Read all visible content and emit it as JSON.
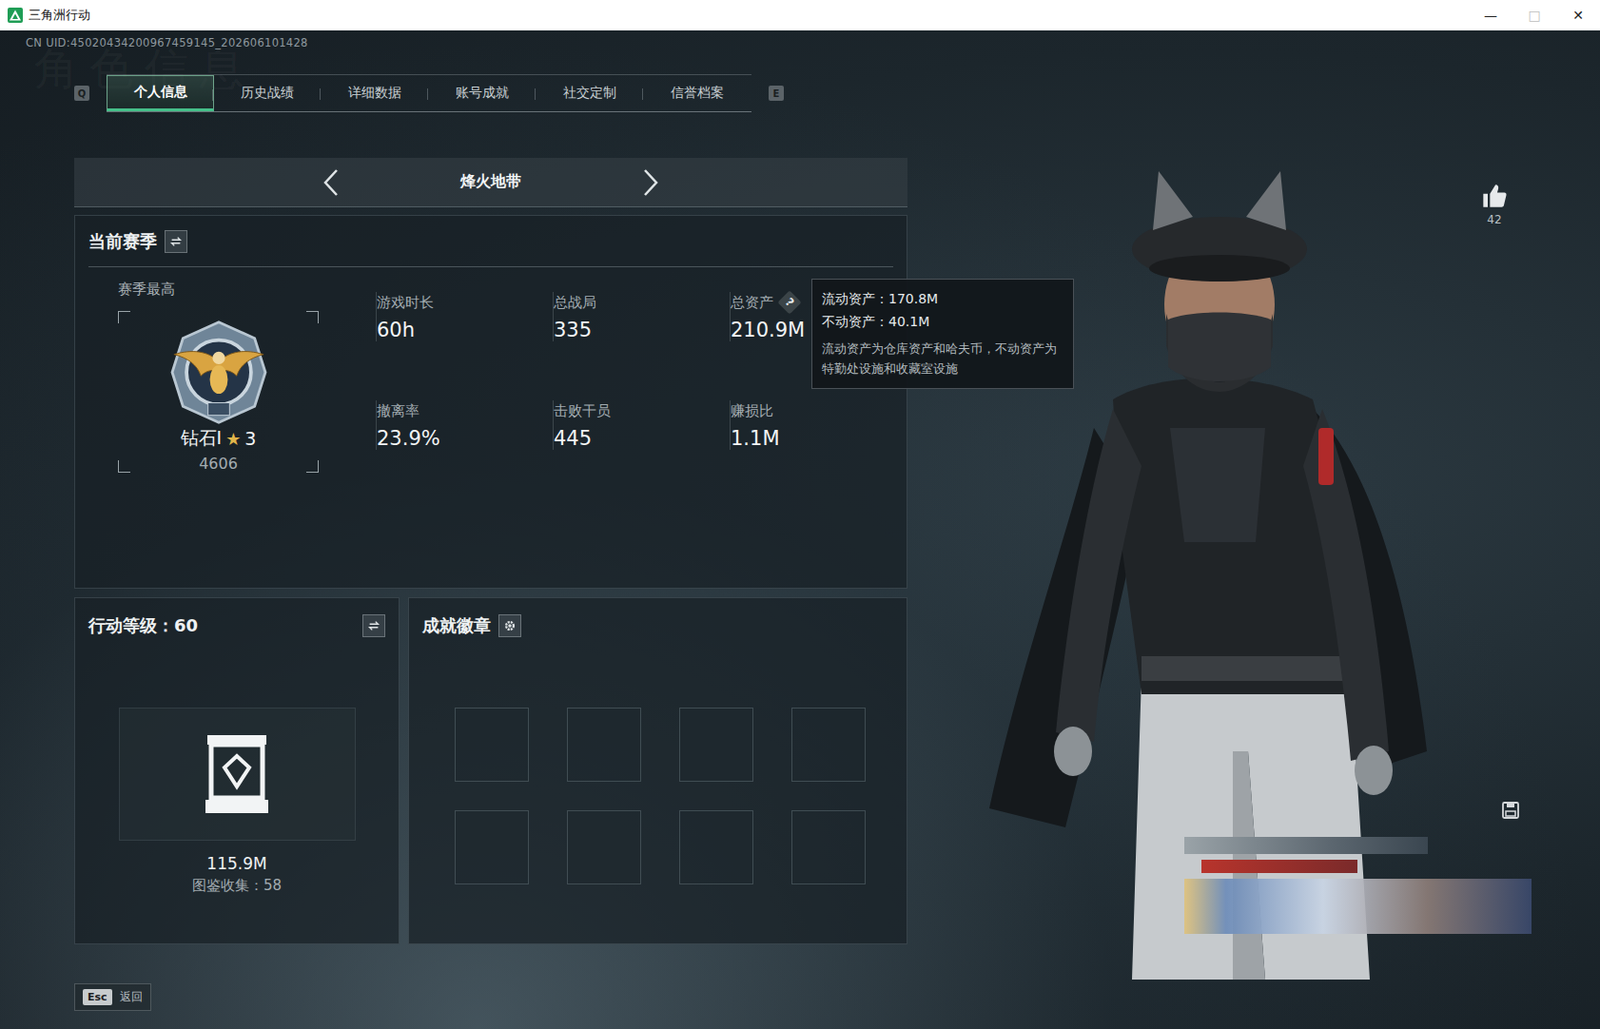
{
  "window": {
    "title": "三角洲行动",
    "controls": [
      {
        "glyph": "—",
        "disabled": false
      },
      {
        "glyph": "□",
        "disabled": true
      },
      {
        "glyph": "✕",
        "disabled": false
      }
    ]
  },
  "uid": "CN UID:45020434200967459145_202606101428",
  "watermark": "角色信息",
  "tabs": {
    "prev_key": "Q",
    "next_key": "E",
    "items": [
      {
        "label": "个人信息",
        "selected": true
      },
      {
        "label": "历史战绩",
        "selected": false
      },
      {
        "label": "详细数据",
        "selected": false
      },
      {
        "label": "账号成就",
        "selected": false
      },
      {
        "label": "社交定制",
        "selected": false
      },
      {
        "label": "信誉档案",
        "selected": false
      }
    ]
  },
  "mode": {
    "label": "烽火地带"
  },
  "season": {
    "title": "当前赛季",
    "best_label": "赛季最高",
    "rank": "钻石I",
    "rank_star": "★",
    "stars": "3",
    "score": "4606",
    "stats": [
      {
        "label": "游戏时长",
        "value": "60h"
      },
      {
        "label": "总战局",
        "value": "335"
      },
      {
        "label": "总资产",
        "value": "210.9M",
        "help": "?"
      },
      {
        "label": "撤离率",
        "value": "23.9%"
      },
      {
        "label": "击败干员",
        "value": "445"
      },
      {
        "label": "赚损比",
        "value": "1.1M"
      }
    ]
  },
  "tooltip": {
    "open": true,
    "lines": [
      "流动资产：170.8M",
      "不动资产：40.1M"
    ],
    "note": "流动资产为仓库资产和哈夫币，不动资产为特勤处设施和收藏室设施"
  },
  "level": {
    "title": "行动等级：60",
    "value": "115.9M",
    "collection": "图鉴收集：58"
  },
  "badges": {
    "title": "成就徽章",
    "slots": [
      {
        "filled": false
      },
      {
        "filled": false
      },
      {
        "filled": false
      },
      {
        "filled": false
      },
      {
        "filled": false
      },
      {
        "filled": false
      },
      {
        "filled": false
      },
      {
        "filled": false
      }
    ]
  },
  "likes": {
    "count": "42"
  },
  "footer": {
    "key": "Esc",
    "label": "返回"
  }
}
